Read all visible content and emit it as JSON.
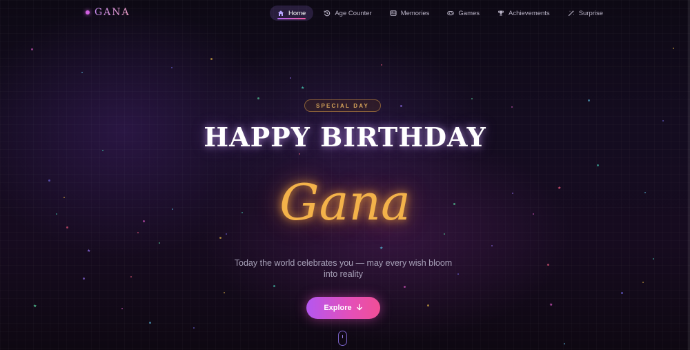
{
  "brand": {
    "name": "GANA",
    "accent": "#d060e0"
  },
  "nav": {
    "items": [
      {
        "label": "Home",
        "icon": "home-icon",
        "active": true
      },
      {
        "label": "Age Counter",
        "icon": "history-icon",
        "active": false
      },
      {
        "label": "Memories",
        "icon": "photo-album-icon",
        "active": false
      },
      {
        "label": "Games",
        "icon": "gamepad-icon",
        "active": false
      },
      {
        "label": "Achievements",
        "icon": "trophy-icon",
        "active": false
      },
      {
        "label": "Surprise",
        "icon": "magic-wand-icon",
        "active": false
      }
    ]
  },
  "hero": {
    "badge": "SPECIAL DAY",
    "title": "HAPPY BIRTHDAY",
    "name": "Gana",
    "subtitle": "Today the world celebrates you — may every wish bloom into reality",
    "cta_label": "Explore",
    "cta_icon": "arrow-down-icon",
    "scroll_icon": "mouse-scroll-icon"
  },
  "colors": {
    "background": "#0b0712",
    "badge_gold": "#d8a55a",
    "name_gold": "#f3b24a",
    "cta_gradient_start": "#b457f0",
    "cta_gradient_end": "#f04f96"
  }
}
